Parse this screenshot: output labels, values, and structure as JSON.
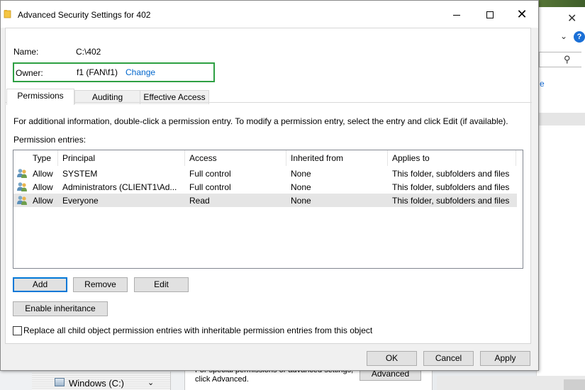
{
  "background": {
    "drive_label": "Windows (C:)",
    "info_text": "For special permissions or advanced settings, click Advanced.",
    "advanced_button": "Advanced",
    "partial_letter": "e"
  },
  "dialog": {
    "title": "Advanced Security Settings for 402",
    "name_label": "Name:",
    "name_value": "C:\\402",
    "owner_label": "Owner:",
    "owner_value": "f1 (FAN\\f1)",
    "owner_change": "Change",
    "tabs": [
      {
        "label": "Permissions",
        "active": true
      },
      {
        "label": "Auditing",
        "active": false
      },
      {
        "label": "Effective Access",
        "active": false
      }
    ],
    "info_text": "For additional information, double-click a permission entry. To modify a permission entry, select the entry and click Edit (if available).",
    "entries_label": "Permission entries:",
    "columns": [
      "Type",
      "Principal",
      "Access",
      "Inherited from",
      "Applies to"
    ],
    "rows": [
      {
        "type": "Allow",
        "principal": "SYSTEM",
        "access": "Full control",
        "inherited": "None",
        "applies": "This folder, subfolders and files",
        "selected": false
      },
      {
        "type": "Allow",
        "principal": "Administrators (CLIENT1\\Ad...",
        "access": "Full control",
        "inherited": "None",
        "applies": "This folder, subfolders and files",
        "selected": false
      },
      {
        "type": "Allow",
        "principal": "Everyone",
        "access": "Read",
        "inherited": "None",
        "applies": "This folder, subfolders and files",
        "selected": true
      }
    ],
    "buttons": {
      "add": "Add",
      "remove": "Remove",
      "edit": "Edit",
      "enable_inheritance": "Enable inheritance",
      "ok": "OK",
      "cancel": "Cancel",
      "apply": "Apply"
    },
    "replace_checkbox_label": "Replace all child object permission entries with inheritable permission entries from this object",
    "replace_checked": false
  },
  "colors": {
    "owner_highlight": "#2ea043",
    "link": "#0066cc",
    "default_button_border": "#0078d7"
  }
}
